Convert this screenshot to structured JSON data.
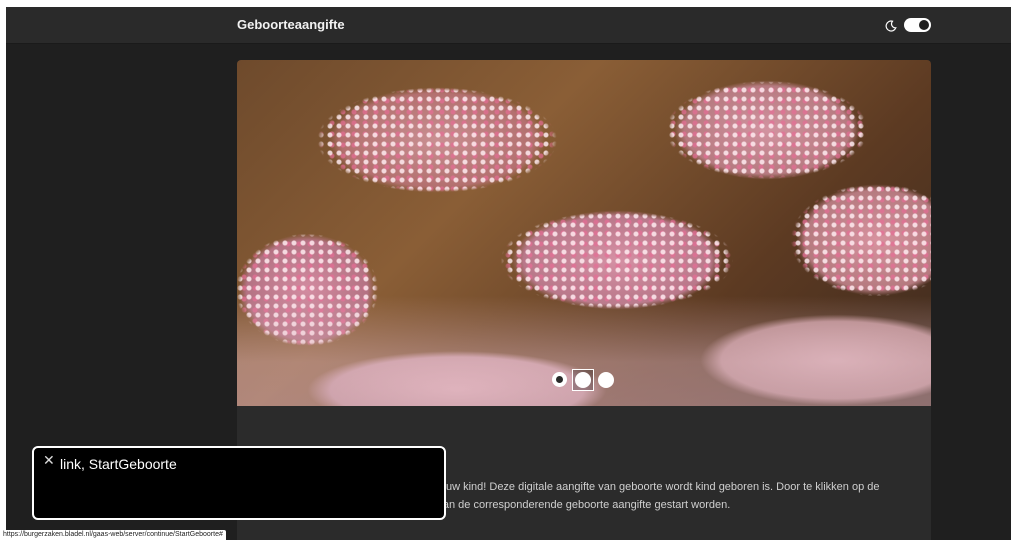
{
  "header": {
    "title": "Geboorteaangifte",
    "theme_icon": "moon-icon",
    "dark_mode_toggle": true
  },
  "carousel": {
    "slides": 3,
    "active_index": 2,
    "image_subject": "beschuit met muisjes"
  },
  "intro": {
    "text": "angifte doen van de geboorte van uw kind! Deze digitale aangifte van geboorte wordt kind geboren is. Door te klikken op de knop jongen, meisje of meerling kan de corresponderende geboorte aangifte gestart worden."
  },
  "hint": {
    "close_icon": "close-icon",
    "label": "link, StartGeboorte"
  },
  "status_bar": {
    "url": "https://burgerzaken.bladel.nl/gaas-web/server/continue/StartGeboorte#"
  },
  "colors": {
    "background": "#1f1f1f",
    "topbar": "#2a2a2a",
    "content_panel": "#2b2b2b",
    "text": "#cfcfcf"
  }
}
